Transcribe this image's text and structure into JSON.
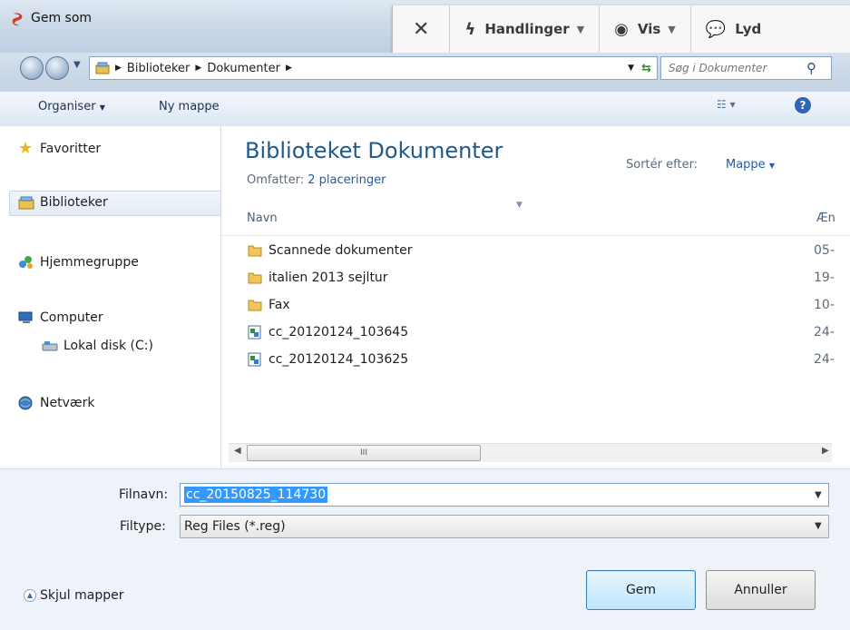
{
  "window": {
    "title": "Gem som"
  },
  "overlay_toolbar": {
    "close_glyph": "✕",
    "actions_label": "Handlinger",
    "view_label": "Vis",
    "sound_label": "Lyd"
  },
  "address": {
    "crumbs": [
      "Biblioteker",
      "Dokumenter"
    ],
    "search_placeholder": "Søg i Dokumenter"
  },
  "command_bar": {
    "organize": "Organiser",
    "new_folder": "Ny mappe"
  },
  "nav": {
    "favorites": "Favoritter",
    "libraries": "Biblioteker",
    "homegroup": "Hjemmegruppe",
    "computer": "Computer",
    "local_disk": "Lokal disk (C:)",
    "network": "Netværk"
  },
  "library": {
    "title": "Biblioteket Dokumenter",
    "includes_label": "Omfatter:",
    "includes_link": "2 placeringer",
    "sort_label": "Sortér efter:",
    "sort_value": "Mappe"
  },
  "columns": {
    "name": "Navn",
    "date": "Æn"
  },
  "files": [
    {
      "name": "Scannede dokumenter",
      "date": "05-",
      "type": "folder"
    },
    {
      "name": "italien 2013 sejltur",
      "date": "19-",
      "type": "folder"
    },
    {
      "name": "Fax",
      "date": "10-",
      "type": "folder"
    },
    {
      "name": "cc_20120124_103645",
      "date": "24-",
      "type": "reg"
    },
    {
      "name": "cc_20120124_103625",
      "date": "24-",
      "type": "reg"
    }
  ],
  "scroll_thumb_glyph": "III",
  "form": {
    "filename_label": "Filnavn:",
    "filename_value": "cc_20150825_114730",
    "filetype_label": "Filtype:",
    "filetype_value": "Reg Files (*.reg)"
  },
  "buttons": {
    "save": "Gem",
    "cancel": "Annuller",
    "hide_folders": "Skjul mapper"
  },
  "colors": {
    "accent": "#1e5a8a",
    "link": "#1f5da6",
    "selection": "#3399ff"
  }
}
